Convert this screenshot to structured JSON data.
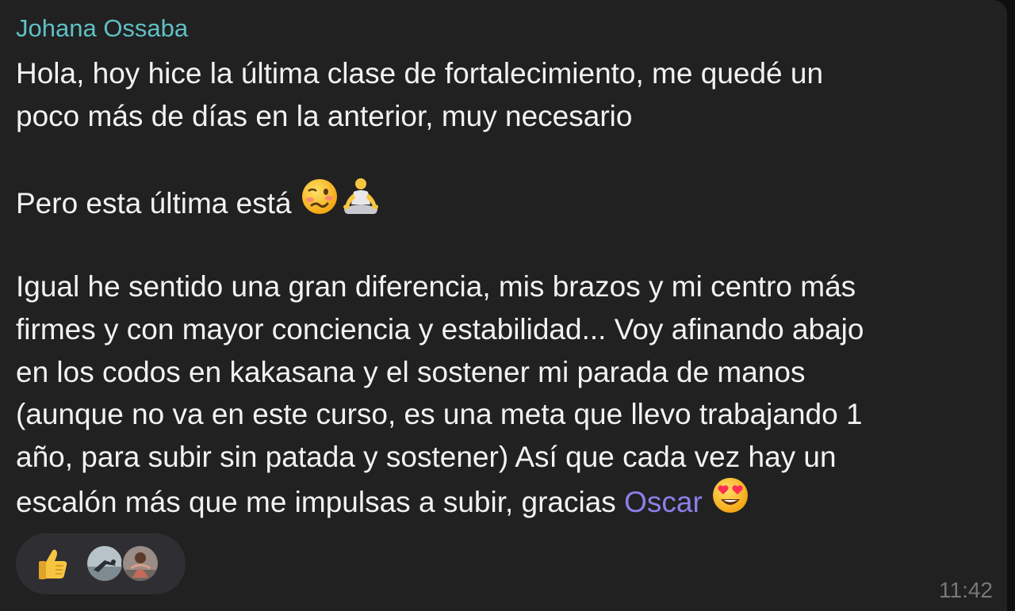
{
  "message": {
    "sender_name": "Johana Ossaba",
    "lines": {
      "l1": "Hola, hoy hice la última clase de fortalecimiento, me quedé un",
      "l2": "poco más de días en la anterior, muy necesario",
      "l3": "Pero esta última está ",
      "l4": "Igual he sentido una gran diferencia, mis brazos y mi centro más",
      "l5": "firmes y con mayor conciencia y estabilidad... Voy afinando abajo",
      "l6": "en los codos en kakasana y el sostener mi parada de manos",
      "l7": "(aunque no va en este curso, es una meta que llevo trabajando 1",
      "l8": "año, para subir sin patada y sostener) Así que cada vez hay un",
      "l9_before_mention": "escalón más que me impulsas a subir, gracias ",
      "l9_mention": "Oscar"
    },
    "emojis": [
      "woozy-face",
      "person-in-lotus-position",
      "heart-eyes-face"
    ],
    "time": "11:42"
  },
  "reactions": {
    "emoji": "thumbs-up",
    "avatars": [
      "reactor-avatar-1",
      "reactor-avatar-2"
    ]
  },
  "colors": {
    "bubble": "#212121",
    "sender": "#5fc0c5",
    "mention": "#8b7fe8",
    "text": "#f2f2f2",
    "time": "#77777c"
  }
}
